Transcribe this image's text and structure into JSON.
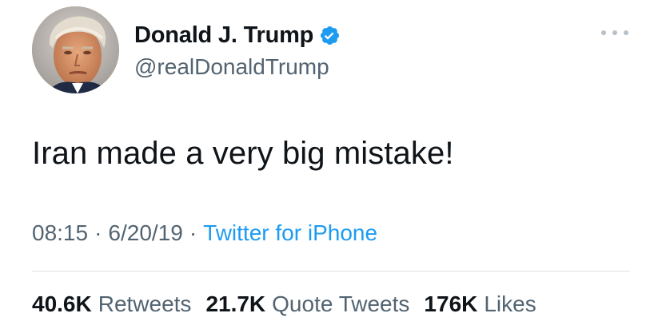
{
  "tweet": {
    "author": {
      "display_name": "Donald J. Trump",
      "handle": "@realDonaldTrump",
      "verified": true,
      "avatar_icon": "profile-photo"
    },
    "menu_icon": "more-options-icon",
    "text": "Iran made a very big mistake!",
    "time": "08:15",
    "date": "6/20/19",
    "separator": "·",
    "source": "Twitter for iPhone",
    "stats": [
      {
        "count": "40.6K",
        "label": "Retweets"
      },
      {
        "count": "21.7K",
        "label": "Quote Tweets"
      },
      {
        "count": "176K",
        "label": "Likes"
      }
    ]
  },
  "colors": {
    "text_primary": "#0f1419",
    "text_secondary": "#536471",
    "link_blue": "#1d9bf0",
    "verified_blue": "#1d9bf0",
    "divider": "#dde2e6"
  }
}
